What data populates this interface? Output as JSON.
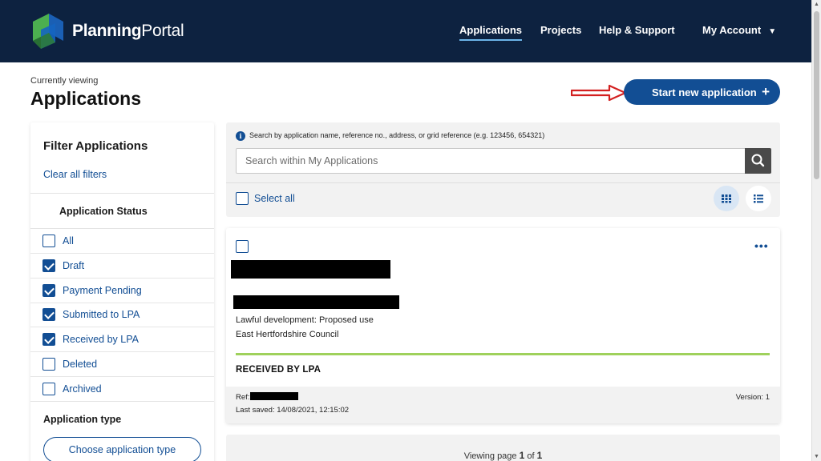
{
  "header": {
    "logo_text_a": "Planning",
    "logo_text_b": "Portal",
    "nav": {
      "applications": "Applications",
      "projects": "Projects",
      "help": "Help & Support",
      "account": "My Account"
    }
  },
  "page": {
    "currently_viewing": "Currently viewing",
    "title": "Applications",
    "start_button": "Start new application"
  },
  "filters": {
    "title": "Filter Applications",
    "clear_all": "Clear all filters",
    "status_title": "Application Status",
    "options": [
      {
        "label": "All",
        "checked": false
      },
      {
        "label": "Draft",
        "checked": true
      },
      {
        "label": "Payment Pending",
        "checked": true
      },
      {
        "label": "Submitted to LPA",
        "checked": true
      },
      {
        "label": "Received by LPA",
        "checked": true
      },
      {
        "label": "Deleted",
        "checked": false
      },
      {
        "label": "Archived",
        "checked": false
      }
    ],
    "app_type_title": "Application type",
    "choose_button": "Choose application type"
  },
  "search": {
    "hint": "Search by application name, reference no., address, or grid reference (e.g. 123456, 654321)",
    "placeholder": "Search within My Applications",
    "select_all": "Select all"
  },
  "card": {
    "menu": "•••",
    "app_type": "Lawful development: Proposed use",
    "council": "East Hertfordshire Council",
    "status": "RECEIVED BY LPA",
    "status_color": "#9fd15c",
    "ref_label": "Ref:",
    "version": "Version: 1",
    "last_saved": "Last saved: 14/08/2021, 12:15:02"
  },
  "pagination": {
    "prefix": "Viewing page",
    "current": "1",
    "of": "of",
    "total": "1"
  },
  "colors": {
    "header_bg": "#0d2240",
    "primary": "#124e94"
  }
}
